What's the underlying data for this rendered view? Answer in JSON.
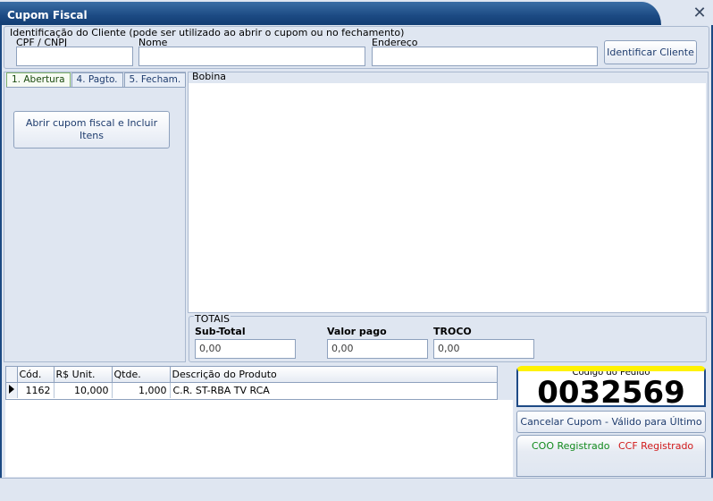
{
  "window": {
    "title": "Cupom Fiscal",
    "close_symbol": "✕"
  },
  "client": {
    "legend": "Identificação do Cliente (pode ser utilizado ao abrir o cupom ou no fechamento)",
    "cpf_label": "CPF / CNPJ",
    "cpf_value": "",
    "nome_label": "Nome",
    "nome_value": "",
    "endereco_label": "Endereço",
    "endereco_value": "",
    "identificar_button": "Identificar Cliente"
  },
  "tabs": [
    {
      "label": "1. Abertura",
      "active": true
    },
    {
      "label": "4. Pagto.",
      "active": false
    },
    {
      "label": "5. Fecham.",
      "active": false
    }
  ],
  "abertura": {
    "button": "Abrir cupom fiscal e Incluir Itens"
  },
  "bobina": {
    "label": "Bobina",
    "content": ""
  },
  "totais": {
    "legend": "TOTAIS",
    "subtotal_label": "Sub-Total",
    "subtotal_value": "0,00",
    "valor_pago_label": "Valor pago",
    "valor_pago_value": "0,00",
    "troco_label": "TROCO",
    "troco_value": "0,00"
  },
  "grid": {
    "columns": [
      "Cód.",
      "R$ Unit.",
      "Qtde.",
      "Descrição do Produto"
    ],
    "rows": [
      {
        "cod": "1162",
        "unit": "10,000",
        "qtde": "1,000",
        "descricao": "C.R. ST-RBA TV RCA"
      }
    ]
  },
  "pedido": {
    "label": "Código do Pedido",
    "number": "0032569"
  },
  "cancelar_button": "Cancelar Cupom - Válido para Último",
  "status": {
    "coo": "COO Registrado",
    "ccf": "CCF Registrado",
    "coo_color": "#118a1c",
    "ccf_color": "#d11a1a"
  },
  "colors": {
    "titlebar": "#1c4a83",
    "pedido_border": "#1e4a86",
    "pedido_highlight": "#fff200"
  }
}
